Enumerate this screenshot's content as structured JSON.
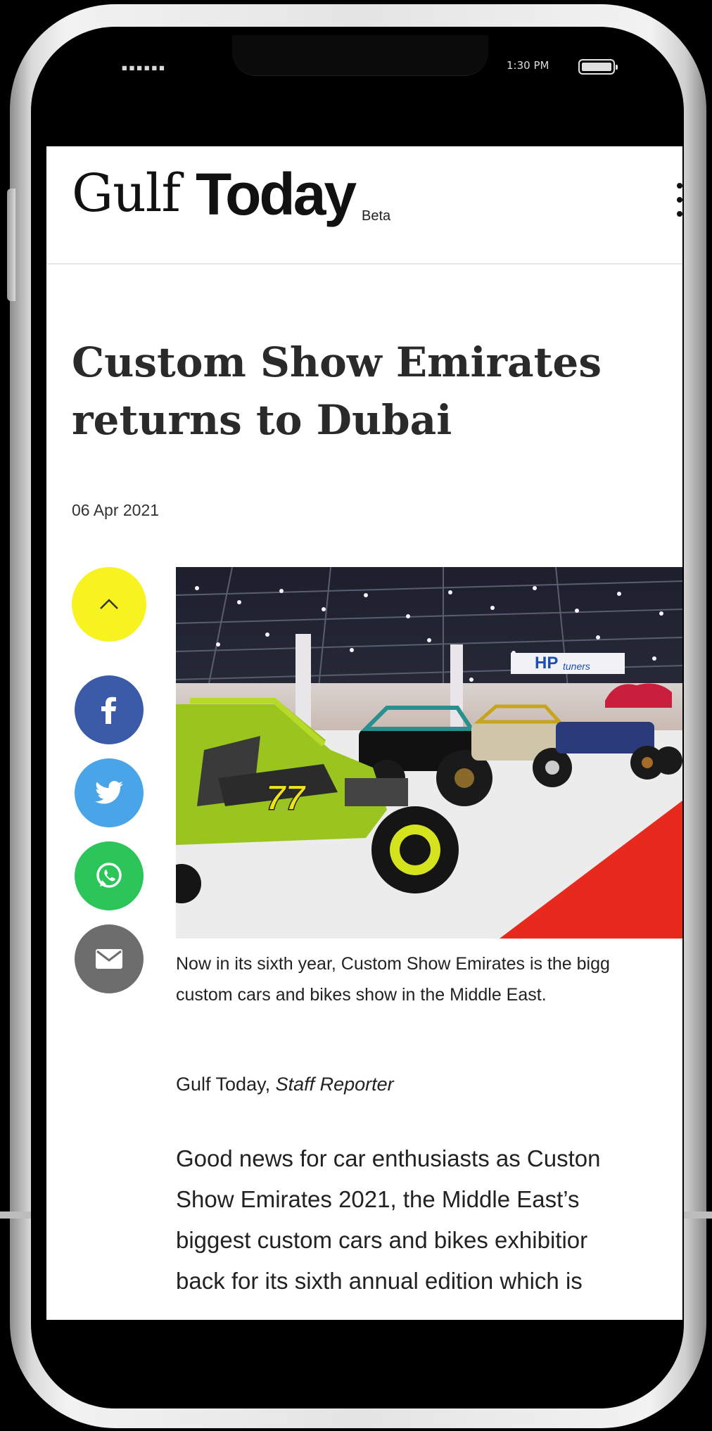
{
  "status_bar": {
    "carrier_signal": "▪▪▪▪▪▪",
    "time": "1:30 PM"
  },
  "header": {
    "logo_part1": "Gulf",
    "logo_part2": "Today",
    "logo_badge": "Beta"
  },
  "article": {
    "title_line1": "Custom Show Emirates",
    "title_line2": "returns to Dubai",
    "date": "06 Apr 2021",
    "caption_line1": "Now in its sixth year, Custom Show Emirates is the bigg",
    "caption_line2": "custom cars and bikes show in the Middle East.",
    "byline_org": "Gulf Today, ",
    "byline_role": "Staff Reporter",
    "body_lines": [
      "Good news for car enthusiasts as Custon",
      "Show Emirates 2021, the Middle East’s",
      "biggest custom cars and bikes exhibitior",
      "back for its sixth annual edition which is"
    ]
  },
  "photo": {
    "banner_text": "HP",
    "banner_subtext": "tuners",
    "car_number": "77"
  },
  "share": {
    "icons": [
      "chevron-up-icon",
      "facebook-icon",
      "twitter-icon",
      "whatsapp-icon",
      "mail-icon"
    ],
    "colors": {
      "top": "#f7f321",
      "facebook": "#3b5ba8",
      "twitter": "#4aa4e8",
      "whatsapp": "#2bc55a",
      "mail": "#6d6d6d"
    }
  }
}
